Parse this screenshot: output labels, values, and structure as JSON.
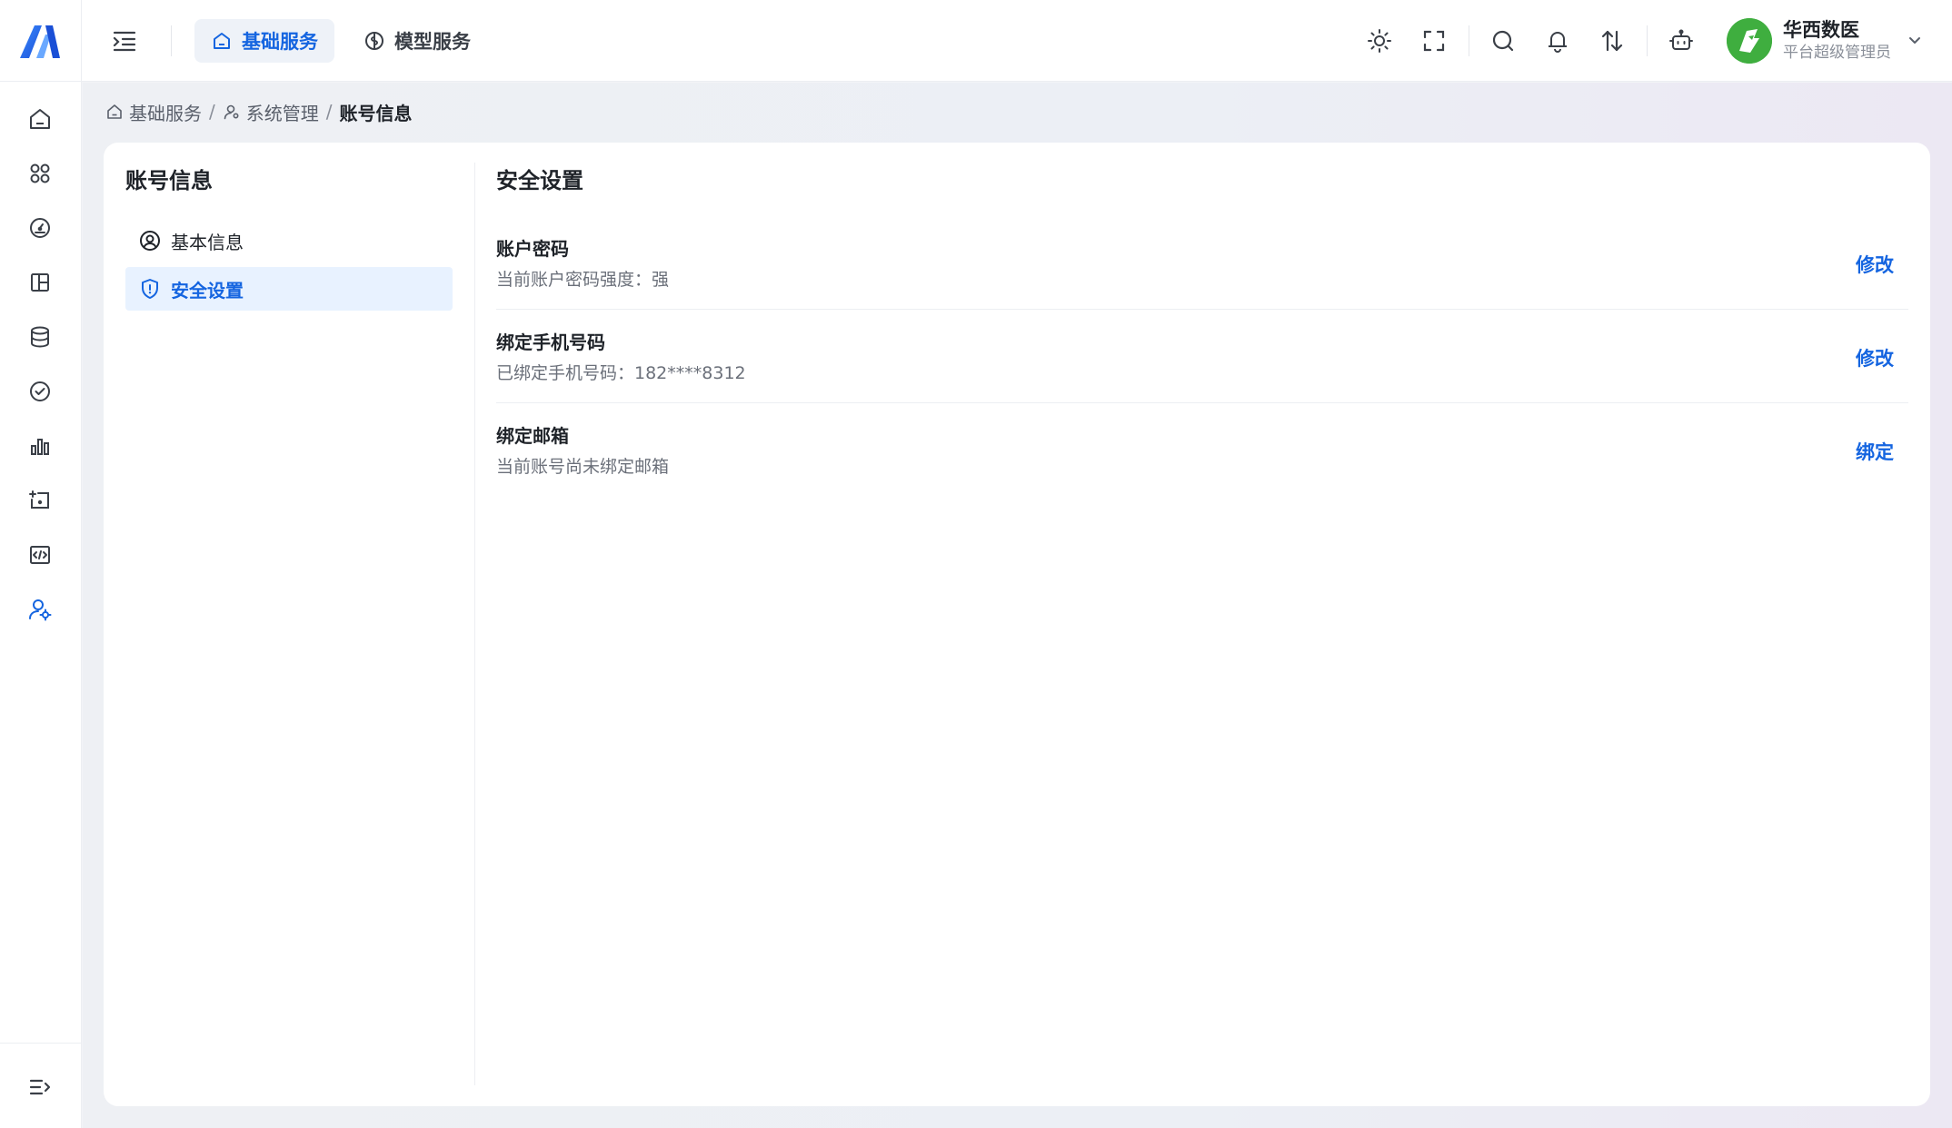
{
  "header": {
    "tabs": [
      {
        "label": "基础服务",
        "icon": "home-icon",
        "active": true
      },
      {
        "label": "模型服务",
        "icon": "brain-icon",
        "active": false
      }
    ],
    "toolbar_icons": [
      "sun-icon",
      "fullscreen-icon",
      "search-icon",
      "bell-icon",
      "sort-arrows-icon",
      "robot-icon"
    ],
    "user": {
      "name": "华西数医",
      "role": "平台超级管理员"
    }
  },
  "sidebar": {
    "items": [
      "home-icon",
      "apps-icon",
      "dashboard-icon",
      "layout-icon",
      "database-icon",
      "check-circle-icon",
      "bar-chart-icon",
      "ticket-icon",
      "code-icon",
      "user-settings-icon"
    ],
    "active_index": 9,
    "bottom": "expand-icon"
  },
  "breadcrumb": {
    "items": [
      "基础服务",
      "系统管理",
      "账号信息"
    ],
    "separator": "/"
  },
  "left_panel": {
    "title": "账号信息",
    "menu": [
      {
        "label": "基本信息",
        "icon": "user-circle-icon",
        "active": false
      },
      {
        "label": "安全设置",
        "icon": "shield-icon",
        "active": true
      }
    ]
  },
  "security": {
    "title": "安全设置",
    "rows": [
      {
        "label": "账户密码",
        "desc": "当前账户密码强度：强",
        "action": "修改"
      },
      {
        "label": "绑定手机号码",
        "desc": "已绑定手机号码：182****8312",
        "action": "修改"
      },
      {
        "label": "绑定邮箱",
        "desc": "当前账号尚未绑定邮箱",
        "action": "绑定"
      }
    ]
  },
  "colors": {
    "accent": "#1565e0",
    "active_bg": "#e8f2ff",
    "avatar": "#3fae3f"
  }
}
